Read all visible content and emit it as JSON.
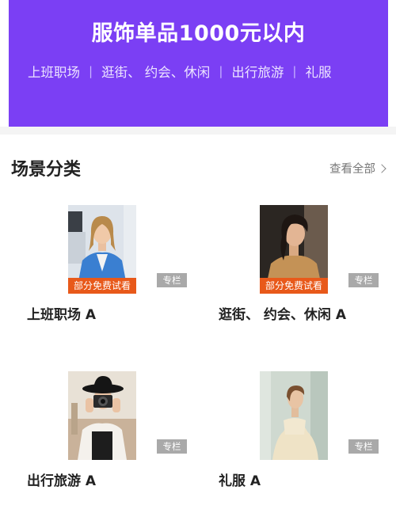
{
  "banner": {
    "title": "服饰单品1000元以内",
    "categories": [
      "上班职场",
      "逛街、 约会、休闲",
      "出行旅游",
      "礼服"
    ],
    "background": "#7b3ff4"
  },
  "section": {
    "title": "场景分类",
    "see_all": "查看全部"
  },
  "cards": [
    {
      "label": "上班职场 A",
      "free_badge": "部分免费试看",
      "tag": "专栏",
      "image": "woman-in-blue-blazer-photo"
    },
    {
      "label": "逛街、 约会、休闲 A",
      "free_badge": "部分免费试看",
      "tag": "专栏",
      "image": "woman-in-camel-top-photo"
    },
    {
      "label": "出行旅游 A",
      "tag": "专栏",
      "image": "woman-with-camera-photo"
    },
    {
      "label": "礼服 A",
      "tag": "专栏",
      "image": "woman-in-cream-gown-photo"
    }
  ],
  "colors": {
    "accent_orange": "#e8591a",
    "tag_gray": "#a9a9a9"
  }
}
